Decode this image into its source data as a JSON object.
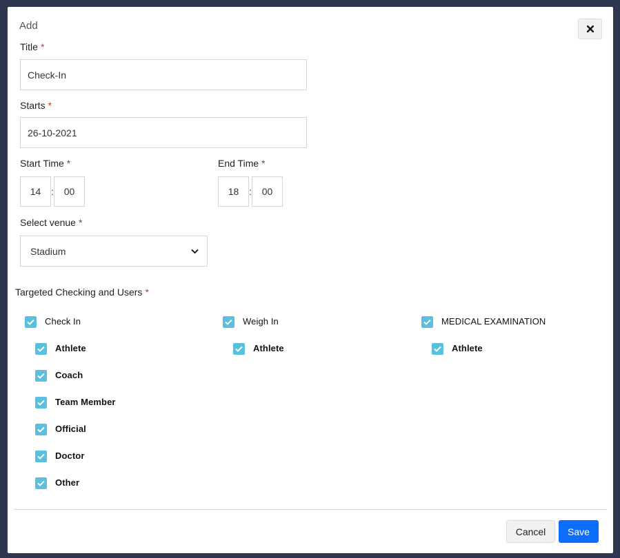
{
  "modal": {
    "title": "Add",
    "close_icon": "close-icon"
  },
  "form": {
    "title_label": "Title",
    "title_value": "Check-In",
    "starts_label": "Starts",
    "starts_value": "26-10-2021",
    "start_time_label": "Start Time",
    "start_time_hour": "14",
    "start_time_minute": "00",
    "end_time_label": "End Time",
    "end_time_hour": "18",
    "end_time_minute": "00",
    "time_separator": ":",
    "required_mark": "*",
    "venue_label": "Select venue",
    "venue_value": "Stadium",
    "targeted_label": "Targeted Checking and Users"
  },
  "checkin_groups": [
    {
      "label": "Check In",
      "checked": true,
      "users": [
        {
          "label": "Athlete",
          "checked": true
        },
        {
          "label": "Coach",
          "checked": true
        },
        {
          "label": "Team Member",
          "checked": true
        },
        {
          "label": "Official",
          "checked": true
        },
        {
          "label": "Doctor",
          "checked": true
        },
        {
          "label": "Other",
          "checked": true
        }
      ]
    },
    {
      "label": "Weigh In",
      "checked": true,
      "users": [
        {
          "label": "Athlete",
          "checked": true
        }
      ]
    },
    {
      "label": "MEDICAL EXAMINATION",
      "checked": true,
      "users": [
        {
          "label": "Athlete",
          "checked": true
        }
      ]
    }
  ],
  "footer": {
    "cancel_label": "Cancel",
    "save_label": "Save"
  },
  "colors": {
    "checkbox": "#5bc0de",
    "primary": "#0d6efd",
    "required": "#c0392b",
    "backdrop": "#2f3650"
  }
}
